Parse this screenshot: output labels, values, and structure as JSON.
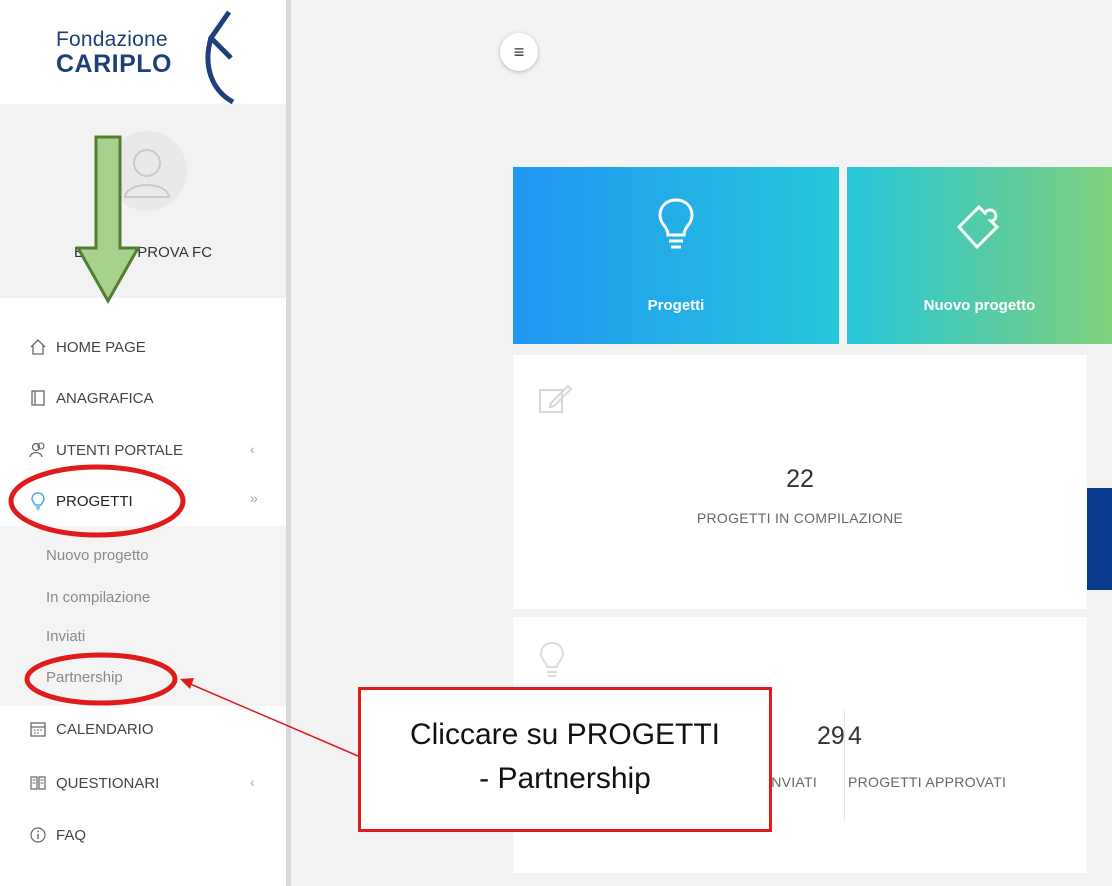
{
  "logo": {
    "line1": "Fondazione",
    "line2": "CARIPLO"
  },
  "user": {
    "name": "ENTE DI PROVA FC"
  },
  "menu": {
    "home": "HOME PAGE",
    "anagrafica": "ANAGRAFICA",
    "utenti": "UTENTI PORTALE",
    "progetti": "PROGETTI",
    "sub": [
      "Nuovo progetto",
      "In compilazione",
      "Inviati",
      "Partnership"
    ],
    "calendario": "CALENDARIO",
    "questionari": "QUESTIONARI",
    "faq": "FAQ"
  },
  "toolbar": {
    "hamburger": "≡"
  },
  "tiles": [
    {
      "label": "Progetti",
      "icon": "lightbulb-icon",
      "colors": [
        "#2196f3",
        "#26c6da"
      ]
    },
    {
      "label": "Nuovo progetto",
      "icon": "puzzle-icon",
      "colors": [
        "#26c6da",
        "#7fd07a"
      ]
    }
  ],
  "stats": {
    "in_compilazione": {
      "value": "22",
      "label": "PROGETTI IN COMPILAZIONE"
    },
    "inviati": {
      "value": "29",
      "label": "INVIATI"
    },
    "approvati": {
      "value": "4",
      "label": "PROGETTI APPROVATI"
    }
  },
  "annotation": {
    "line1": "Cliccare su PROGETTI",
    "line2": "- Partnership"
  },
  "colors": {
    "accent": "#e01b1b",
    "arrow": "#a9d18e",
    "brand": "#1e3f7a"
  }
}
